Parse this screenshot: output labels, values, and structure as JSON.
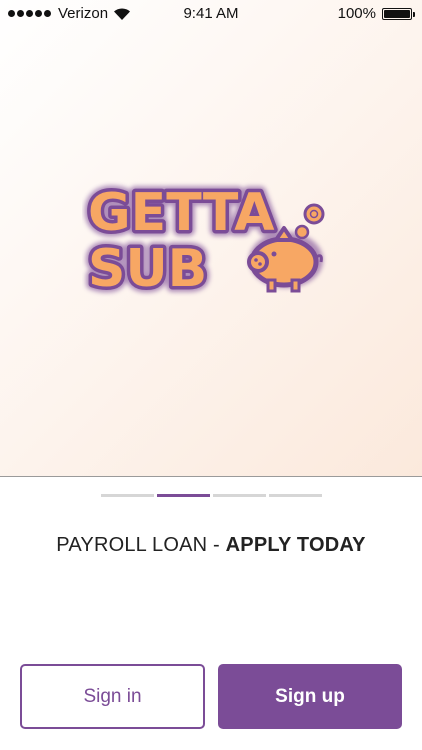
{
  "status_bar": {
    "carrier": "Verizon",
    "time": "9:41 AM",
    "battery": "100%",
    "battery_level": 1.0
  },
  "logo": {
    "line1": "GETTA",
    "line2": "SUB",
    "icon": "piggy-bank-icon",
    "colors": {
      "fill": "#f7a764",
      "outline": "#7b4c97"
    }
  },
  "pager": {
    "pages": 4,
    "active_index": 1
  },
  "tagline": {
    "normal": "PAYROLL LOAN - ",
    "bold": "APPLY TODAY"
  },
  "buttons": {
    "sign_in": "Sign in",
    "sign_up": "Sign up"
  },
  "colors": {
    "accent": "#7b4c97",
    "inactive_dot": "#d6d6d6"
  }
}
